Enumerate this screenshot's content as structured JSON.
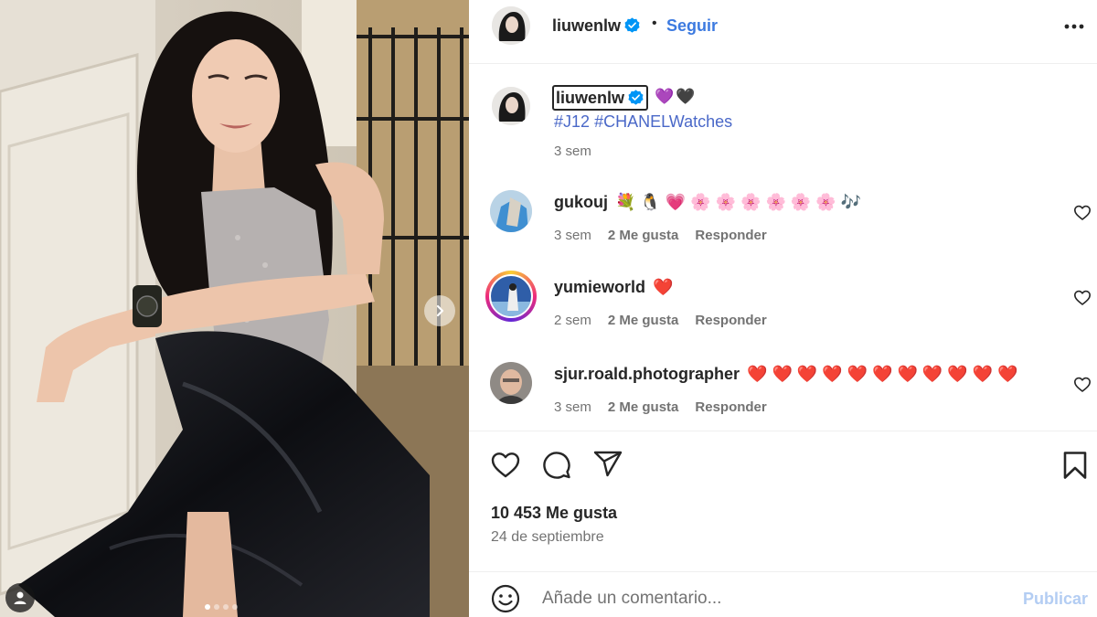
{
  "post": {
    "author": "liuwenlw",
    "follow_label": "Seguir",
    "separator": "•",
    "more_icon": "more-horizontal-icon"
  },
  "caption": {
    "username": "liuwenlw",
    "emojis": "💜🖤",
    "hashtags": [
      "#J12",
      "#CHANELWatches"
    ],
    "time": "3 sem"
  },
  "comments": [
    {
      "username": "gukouj",
      "text": "💐 🐧 💗 🌸 🌸 🌸 🌸 🌸 🌸 🎶",
      "time": "3 sem",
      "likes": "2 Me gusta",
      "reply": "Responder"
    },
    {
      "username": "yumieworld",
      "text": "❤️",
      "time": "2 sem",
      "likes": "2 Me gusta",
      "reply": "Responder"
    },
    {
      "username": "sjur.roald.photographer",
      "text": "❤️ ❤️ ❤️ ❤️ ❤️ ❤️ ❤️ ❤️ ❤️ ❤️ ❤️",
      "time": "3 sem",
      "likes": "2 Me gusta",
      "reply": "Responder"
    }
  ],
  "stats": {
    "likes": "10 453 Me gusta",
    "date": "24 de septiembre"
  },
  "composer": {
    "placeholder": "Añade un comentario...",
    "publish_label": "Publicar"
  },
  "carousel": {
    "slide_count": 4,
    "active_index": 0
  },
  "colors": {
    "link": "#3c7ae0",
    "hashtag": "#4a68c8",
    "publish_disabled": "#b3cdf3",
    "verified": "#0095f6"
  }
}
